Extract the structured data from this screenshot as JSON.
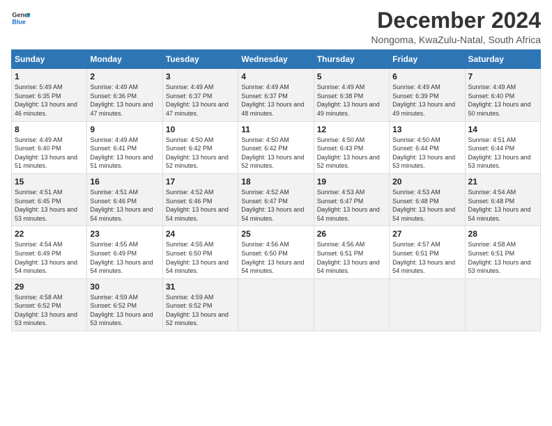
{
  "logo": {
    "line1": "General",
    "line2": "Blue"
  },
  "title": "December 2024",
  "subtitle": "Nongoma, KwaZulu-Natal, South Africa",
  "weekdays": [
    "Sunday",
    "Monday",
    "Tuesday",
    "Wednesday",
    "Thursday",
    "Friday",
    "Saturday"
  ],
  "weeks": [
    [
      {
        "day": "1",
        "sunrise": "5:49 AM",
        "sunset": "6:35 PM",
        "daylight": "13 hours and 46 minutes."
      },
      {
        "day": "2",
        "sunrise": "4:49 AM",
        "sunset": "6:36 PM",
        "daylight": "13 hours and 47 minutes."
      },
      {
        "day": "3",
        "sunrise": "4:49 AM",
        "sunset": "6:37 PM",
        "daylight": "13 hours and 47 minutes."
      },
      {
        "day": "4",
        "sunrise": "4:49 AM",
        "sunset": "6:37 PM",
        "daylight": "13 hours and 48 minutes."
      },
      {
        "day": "5",
        "sunrise": "4:49 AM",
        "sunset": "6:38 PM",
        "daylight": "13 hours and 49 minutes."
      },
      {
        "day": "6",
        "sunrise": "4:49 AM",
        "sunset": "6:39 PM",
        "daylight": "13 hours and 49 minutes."
      },
      {
        "day": "7",
        "sunrise": "4:49 AM",
        "sunset": "6:40 PM",
        "daylight": "13 hours and 50 minutes."
      }
    ],
    [
      {
        "day": "8",
        "sunrise": "4:49 AM",
        "sunset": "6:40 PM",
        "daylight": "13 hours and 51 minutes."
      },
      {
        "day": "9",
        "sunrise": "4:49 AM",
        "sunset": "6:41 PM",
        "daylight": "13 hours and 51 minutes."
      },
      {
        "day": "10",
        "sunrise": "4:50 AM",
        "sunset": "6:42 PM",
        "daylight": "13 hours and 52 minutes."
      },
      {
        "day": "11",
        "sunrise": "4:50 AM",
        "sunset": "6:42 PM",
        "daylight": "13 hours and 52 minutes."
      },
      {
        "day": "12",
        "sunrise": "4:50 AM",
        "sunset": "6:43 PM",
        "daylight": "13 hours and 52 minutes."
      },
      {
        "day": "13",
        "sunrise": "4:50 AM",
        "sunset": "6:44 PM",
        "daylight": "13 hours and 53 minutes."
      },
      {
        "day": "14",
        "sunrise": "4:51 AM",
        "sunset": "6:44 PM",
        "daylight": "13 hours and 53 minutes."
      }
    ],
    [
      {
        "day": "15",
        "sunrise": "4:51 AM",
        "sunset": "6:45 PM",
        "daylight": "13 hours and 53 minutes."
      },
      {
        "day": "16",
        "sunrise": "4:51 AM",
        "sunset": "6:46 PM",
        "daylight": "13 hours and 54 minutes."
      },
      {
        "day": "17",
        "sunrise": "4:52 AM",
        "sunset": "6:46 PM",
        "daylight": "13 hours and 54 minutes."
      },
      {
        "day": "18",
        "sunrise": "4:52 AM",
        "sunset": "6:47 PM",
        "daylight": "13 hours and 54 minutes."
      },
      {
        "day": "19",
        "sunrise": "4:53 AM",
        "sunset": "6:47 PM",
        "daylight": "13 hours and 54 minutes."
      },
      {
        "day": "20",
        "sunrise": "4:53 AM",
        "sunset": "6:48 PM",
        "daylight": "13 hours and 54 minutes."
      },
      {
        "day": "21",
        "sunrise": "4:54 AM",
        "sunset": "6:48 PM",
        "daylight": "13 hours and 54 minutes."
      }
    ],
    [
      {
        "day": "22",
        "sunrise": "4:54 AM",
        "sunset": "6:49 PM",
        "daylight": "13 hours and 54 minutes."
      },
      {
        "day": "23",
        "sunrise": "4:55 AM",
        "sunset": "6:49 PM",
        "daylight": "13 hours and 54 minutes."
      },
      {
        "day": "24",
        "sunrise": "4:55 AM",
        "sunset": "6:50 PM",
        "daylight": "13 hours and 54 minutes."
      },
      {
        "day": "25",
        "sunrise": "4:56 AM",
        "sunset": "6:50 PM",
        "daylight": "13 hours and 54 minutes."
      },
      {
        "day": "26",
        "sunrise": "4:56 AM",
        "sunset": "6:51 PM",
        "daylight": "13 hours and 54 minutes."
      },
      {
        "day": "27",
        "sunrise": "4:57 AM",
        "sunset": "6:51 PM",
        "daylight": "13 hours and 54 minutes."
      },
      {
        "day": "28",
        "sunrise": "4:58 AM",
        "sunset": "6:51 PM",
        "daylight": "13 hours and 53 minutes."
      }
    ],
    [
      {
        "day": "29",
        "sunrise": "4:58 AM",
        "sunset": "6:52 PM",
        "daylight": "13 hours and 53 minutes."
      },
      {
        "day": "30",
        "sunrise": "4:59 AM",
        "sunset": "6:52 PM",
        "daylight": "13 hours and 53 minutes."
      },
      {
        "day": "31",
        "sunrise": "4:59 AM",
        "sunset": "6:52 PM",
        "daylight": "13 hours and 52 minutes."
      },
      null,
      null,
      null,
      null
    ]
  ]
}
